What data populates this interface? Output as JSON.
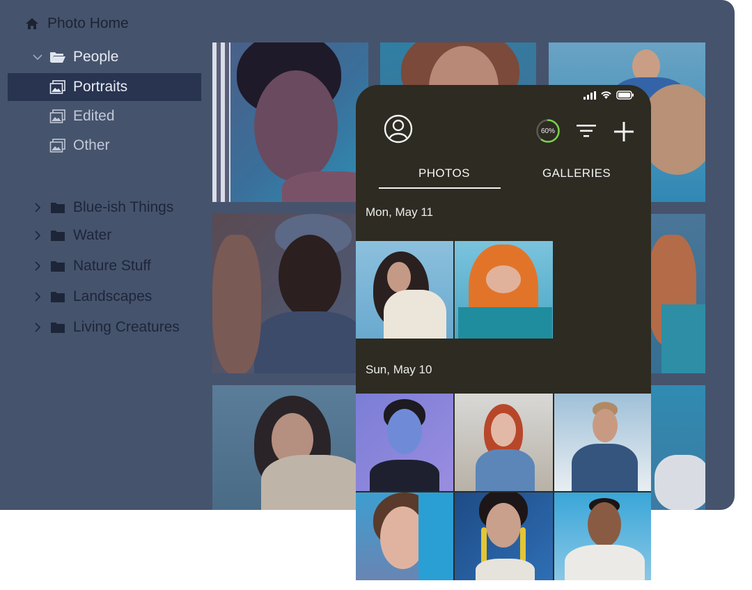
{
  "sidebar": {
    "home": {
      "label": "Photo Home",
      "icon": "home-icon"
    },
    "people": {
      "label": "People",
      "icon": "folder-open-icon"
    },
    "people_children": [
      {
        "label": "Portraits",
        "icon": "album-icon",
        "selected": true
      },
      {
        "label": "Edited",
        "icon": "album-icon",
        "selected": false
      },
      {
        "label": "Other",
        "icon": "album-icon",
        "selected": false
      }
    ],
    "folders": [
      {
        "label": "Blue-ish Things",
        "icon": "folder-icon"
      },
      {
        "label": "Water",
        "icon": "folder-icon"
      },
      {
        "label": "Nature Stuff",
        "icon": "folder-icon"
      },
      {
        "label": "Landscapes",
        "icon": "folder-icon"
      },
      {
        "label": "Living Creatures",
        "icon": "folder-icon"
      }
    ]
  },
  "phone": {
    "progress": {
      "label": "60%",
      "value": 0.6,
      "color": "#7bd14a"
    },
    "tabs": {
      "photos": "PHOTOS",
      "galleries": "GALLERIES",
      "active": "photos"
    },
    "sections": [
      {
        "date": "Mon, May 11",
        "photo_count": 2
      },
      {
        "date": "Sun, May 10",
        "photo_count": 6
      }
    ]
  },
  "colors": {
    "desktop_bg": "#46536d",
    "selected_row": "#283450",
    "phone_bg": "#2d2b22"
  }
}
